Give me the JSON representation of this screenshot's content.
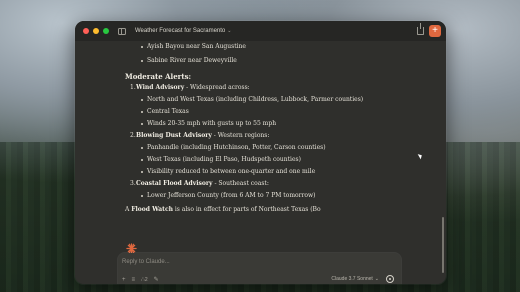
{
  "window": {
    "title": "Weather Forecast for Sacramento"
  },
  "content": {
    "top_bullets": [
      "Ayish Bayou near San Augustine",
      "Sabine River near Deweyville"
    ],
    "heading": "Moderate Alerts:",
    "alerts": [
      {
        "num": "1.",
        "name": "Wind Advisory",
        "desc": " - Widespread across:",
        "bullets": [
          "North and West Texas (including Childress, Lubbock, Parmer counties)",
          "Central Texas",
          "Winds 20-35 mph with gusts up to 55 mph"
        ]
      },
      {
        "num": "2.",
        "name": "Blowing Dust Advisory",
        "desc": " - Western regions:",
        "bullets": [
          "Panhandle (including Hutchinson, Potter, Carson counties)",
          "West Texas (including El Paso, Hudspeth counties)",
          "Visibility reduced to between one-quarter and one mile"
        ]
      },
      {
        "num": "3.",
        "name": "Coastal Flood Advisory",
        "desc": " - Southeast coast:",
        "bullets": [
          "Lower Jefferson County (from 6 AM to 7 PM tomorrow)"
        ]
      }
    ],
    "closing_prefix": "A ",
    "closing_bold": "Flood Watch",
    "closing_rest": " is also in effect for parts of Northeast Texas (Bo"
  },
  "composer": {
    "placeholder": "Reply to Claude...",
    "tool_count": "2",
    "model": "Claude 3.7 Sonnet"
  },
  "colors": {
    "accent": "#e0683f",
    "background": "#2f2f2c"
  }
}
